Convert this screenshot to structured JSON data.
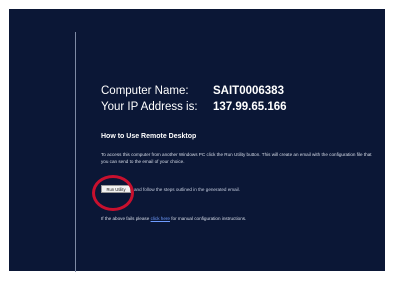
{
  "computer": {
    "name_label": "Computer Name:",
    "name_value": "SAIT0006383",
    "ip_label": "Your IP Address is:",
    "ip_value": "137.99.65.166"
  },
  "remote": {
    "title": "How to Use Remote Desktop",
    "instructions": "To access this computer from another Windows PC click the Run Utility button. This will create an email with the configuration file that you can send to the email of your choice.",
    "run_button_label": "Run Utility",
    "after_button_text": "and follow the steps outlined in the generated email.",
    "fallback_prefix": "If the above fails please",
    "fallback_link": "click here",
    "fallback_suffix": "for manual configuration instructions."
  },
  "colors": {
    "background": "#0b1736",
    "link": "#6f9cff",
    "highlight": "#c8102e"
  }
}
